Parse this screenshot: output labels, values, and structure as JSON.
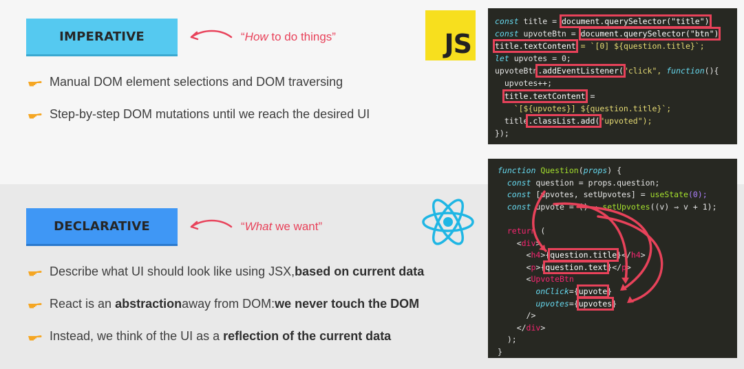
{
  "imperative": {
    "badge": "IMPERATIVE",
    "tagline_pre": "“",
    "tagline_em": "How",
    "tagline_post": " to do things”",
    "bullets": [
      "Manual DOM element selections and DOM traversing",
      "Step-by-step DOM mutations until we reach the desired UI"
    ]
  },
  "declarative": {
    "badge": "DECLARATIVE",
    "tagline_pre": "“",
    "tagline_em": "What",
    "tagline_post": " we want”",
    "bullets": [
      {
        "a": "Describe what UI should look like using JSX, ",
        "b": "based on current data"
      },
      {
        "a": "React is an ",
        "b": "abstraction",
        "c": " away from DOM: ",
        "d": "we never touch the DOM"
      },
      {
        "a": "Instead, we think of the UI as a ",
        "b": "reflection of the current data"
      }
    ]
  },
  "logos": {
    "js_text": "JS",
    "js_icon": "javascript-logo",
    "react_icon": "react-logo"
  },
  "icons": {
    "bullet": "pointing-hand-icon",
    "arrow": "curved-arrow-icon"
  },
  "colors": {
    "accent": "#e8425a",
    "imperative_badge": "#55c9f0",
    "declarative_badge": "#3f97f5",
    "code_bg": "#272822"
  },
  "code_js": {
    "l1_kw": "const",
    "l1_a": " title = ",
    "l1_hl": "document.querySelector(\"title\")",
    "l2_kw": "const",
    "l2_a": " upvoteBtn = ",
    "l2_hl": "document.querySelector(\"btn\")",
    "l3_hl": "title.textContent",
    "l3_a": " = `[0] ${question.title}`;",
    "l4_kw": "let",
    "l4_a": " upvotes = 0;",
    "l5_a": "upvoteBtn",
    "l5_hl": ".addEventListener(",
    "l5_b": "\"click\", ",
    "l5_kw": "function",
    "l5_c": "(){",
    "l6_a": "  upvotes++;",
    "l7_hl": "title.textContent",
    "l7_a": " =",
    "l8_a": "    `[${upvotes}] ${question.title}`;",
    "l9_a": "  title",
    "l9_hl": ".classList.add(",
    "l9_b": "\"upvoted\");",
    "l10_a": "});"
  },
  "code_react": {
    "l1_kw": "function",
    "l1_fn": " Question",
    "l1_a": "(",
    "l1_p": "props",
    "l1_b": ") {",
    "l2_kw": "  const",
    "l2_a": " question = props.question;",
    "l3_kw": "  const",
    "l3_a": " [upvotes, setUpvotes] = ",
    "l3_fn": "useState",
    "l3_b": "(0);",
    "l4_kw": "  const",
    "l4_a": " upvote = () ⇒ ",
    "l4_fn": "setUpvotes",
    "l4_b": "((v) ⇒ v + 1);",
    "l5_a": "",
    "l6_kw": "  return",
    "l6_a": " (",
    "l7_a": "    <",
    "l7_t": "div",
    "l7_b": ">",
    "l8_a": "      <",
    "l8_t": "h4",
    "l8_b": ">{",
    "l8_hl": "question.title",
    "l8_c": "}</",
    "l8_t2": "h4",
    "l8_d": ">",
    "l9_a": "      <",
    "l9_t": "p",
    "l9_b": ">{",
    "l9_hl": "question.text",
    "l9_c": "}</",
    "l9_t2": "p",
    "l9_d": ">",
    "l10_a": "      <",
    "l10_t": "UpvoteBtn",
    "l11_attr": "        onClick",
    "l11_a": "={",
    "l11_hl": "upvote",
    "l11_b": "}",
    "l12_attr": "        upvotes",
    "l12_a": "={",
    "l12_hl": "upvotes",
    "l12_b": "}",
    "l13_a": "      />",
    "l14_a": "    </",
    "l14_t": "div",
    "l14_b": ">",
    "l15_a": "  );",
    "l16_a": "}"
  }
}
